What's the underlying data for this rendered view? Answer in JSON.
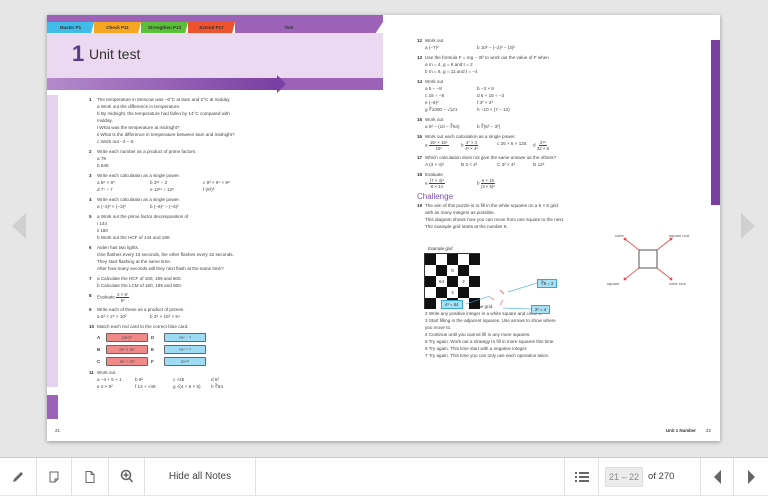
{
  "tabs": [
    {
      "label": "Master P1",
      "color": "#3fbde8"
    },
    {
      "label": "Check P11",
      "color": "#f5a623"
    },
    {
      "label": "Strengthen P13",
      "color": "#5cbf3a"
    },
    {
      "label": "Extend P17",
      "color": "#ee5330"
    },
    {
      "label": "Test",
      "color": "#9b62b8"
    }
  ],
  "header": {
    "unit_number": "1",
    "title": "Unit test"
  },
  "left_questions": [
    {
      "n": "1",
      "rows": [
        [
          "The temperature in Moscow was −6°C at 6am and 2°C at midday."
        ],
        [
          "a  Work out the difference in temperature."
        ],
        [
          "b  By midnight, the temperature had fallen by 14°C compared with"
        ],
        [
          "    midday."
        ],
        [
          "    i  What was the temperature at midnight?"
        ],
        [
          "    ii  What is the difference in temperature between 6am and midnight?"
        ],
        [
          "c  Work out −4 − 6."
        ]
      ]
    },
    {
      "n": "2",
      "rows": [
        [
          "Write each number as a product of prime factors."
        ],
        [
          "a  78"
        ],
        [
          "b  648"
        ]
      ]
    },
    {
      "n": "3",
      "rows": [
        [
          "Write each calculation as a single power."
        ],
        [
          "a  8⁶ × 8⁵",
          "b  3¹¹ ÷ 3",
          "c  9³ × 9⁷ × 9⁸"
        ],
        [
          "d  7⁷ ÷ 7",
          "e  12¹¹ ÷ 12⁵",
          "f  (6²)³"
        ]
      ]
    },
    {
      "n": "4",
      "rows": [
        [
          "Write each calculation as a single power."
        ],
        [
          "a  (−3)² × (−3)²",
          "b  (−6)⁷ ÷ (−6)²"
        ]
      ]
    },
    {
      "n": "5",
      "rows": [
        [
          "a  Work out the prime factor decomposition of"
        ],
        [
          "    i  144"
        ],
        [
          "    ii  180"
        ],
        [
          "b  Work out the HCF of 144 and 180."
        ]
      ]
    },
    {
      "n": "6",
      "rows": [
        [
          "Aiden has two lights."
        ],
        [
          "One flashes every 15 seconds, the other flashes every 42 seconds."
        ],
        [
          "They start flashing at the same time."
        ],
        [
          "After how many seconds will they next flash at the same time?"
        ]
      ]
    },
    {
      "n": "7",
      "rows": [
        [
          "a  Calculate the HCF of 180, 189 and 600."
        ],
        [
          "b  Calculate the LCM of 180, 189 and 600."
        ]
      ]
    },
    {
      "n": "8",
      "rows": [
        [
          "Evaluate {2 × 5⁷|5⁵}"
        ]
      ]
    },
    {
      "n": "9",
      "rows": [
        [
          "Write each of these as a product of primes."
        ],
        [
          "a  5³ × 2⁵ × 10²",
          "b  3⁵ × 15³ × 5⁴"
        ]
      ]
    },
    {
      "n": "10",
      "rows": [
        [
          "Match each red card to the correct blue card."
        ]
      ]
    }
  ],
  "cards": [
    {
      "letter": "A",
      "value": "(m⁴)³",
      "kind": "red"
    },
    {
      "letter": "D",
      "value": "m⁴ ⁻ ³",
      "kind": "blue"
    },
    {
      "letter": "B",
      "value": "m⁴ × m³",
      "kind": "red"
    },
    {
      "letter": "E",
      "value": "m⁴ ⁺ ³",
      "kind": "blue"
    },
    {
      "letter": "C",
      "value": "m⁴ ÷ m³",
      "kind": "red"
    },
    {
      "letter": "F",
      "value": "m⁴ˣ³",
      "kind": "blue"
    }
  ],
  "q11": {
    "n": "11",
    "rows": [
      [
        "Work out"
      ],
      [
        "a  −4 + 5 + 1",
        "b  9²",
        "c  √25",
        "d  5³"
      ],
      [
        "e  2 × 5²",
        "f  13 + √49",
        "g  √(4 + 9 × 5)",
        "h  ∛64"
      ]
    ]
  },
  "right_questions": [
    {
      "n": "12",
      "rows": [
        [
          "Work out"
        ],
        [
          "a  (−7)²",
          "b  10² − (−2)² − (3)²"
        ]
      ]
    },
    {
      "n": "13",
      "rows": [
        [
          "Use the formula F = mg − 3t² to work out the value of F when"
        ],
        [
          "a  m = 4, g = 6 and t = 2"
        ],
        [
          "b  m = 6, g = 11 and t = −4"
        ]
      ]
    },
    {
      "n": "14",
      "rows": [
        [
          "Work out"
        ],
        [
          "a  5 − −8",
          "b  −3 × 8"
        ],
        [
          "c  16 ÷ −8",
          "d  6 + 15 ÷ −3"
        ],
        [
          "e  (−6)²",
          "f  3² × 2³"
        ],
        [
          "g  ∛1000 − √121",
          "h  −10 × (7 − 12)"
        ]
      ]
    },
    {
      "n": "15",
      "rows": [
        [
          "Work out"
        ],
        [
          "a  5² − (10 − ∛64)",
          "b  ∛(6² − 3²)"
        ]
      ]
    },
    {
      "n": "16",
      "rows": [
        [
          "Work out each calculation as a single power."
        ],
        [
          "a  {15³ × 15⁵|15²}",
          "b  {4⁷ × 4|4² × 4³}",
          "c  25 × 5 × 125",
          "d  {2¹⁶|32 × 8}"
        ]
      ]
    },
    {
      "n": "17",
      "rows": [
        [
          "Which calculation does not give the same answer as the others?"
        ],
        [
          "A  (3 × 4)²",
          "B  3 × 4²",
          "C  3² × 4²",
          "D  12²"
        ]
      ]
    },
    {
      "n": "18",
      "rows": [
        [
          "Evaluate"
        ],
        [
          "a  {(7 × 4)²|8 × 14}",
          "b  {6 × 15|(3 × 5)²}"
        ]
      ]
    }
  ],
  "challenge": {
    "title": "Challenge",
    "n": "19",
    "intro": [
      "The aim of this puzzle is to fill in the white squares on a 5 × 5 grid",
      "with as many integers as possible.",
      "This diagram shows how you can move from one square to the next.",
      "The example grid starts at the number 8."
    ],
    "grid_caption": "Example grid",
    "grid_numbers": {
      "1-2": "8",
      "2-1": "64",
      "2-3": "2",
      "3-2": "4"
    },
    "labels": {
      "cube_root_label": "∛8 = 2",
      "cube_label": "4³ = 64",
      "square_label": "2² = 4"
    },
    "diagram": {
      "tl": "cube",
      "tr": "square root",
      "bl": "square",
      "br": "cube root"
    },
    "steps": [
      "1  Draw your own copy of the grid.",
      "2  Write any positive integer in a white square and circle it.",
      "3  Start filling in the adjacent squares. Use arrows to show where",
      "    you move to.",
      "4  Continue until you cannot fill in any more squares.",
      "5  Try again. Work out a strategy to fill in more squares this time.",
      "6  Try again. This time start with a negative integer.",
      "7  Try again. This time you can only use each operation twice."
    ]
  },
  "footer": {
    "left_page": "21",
    "right_label": "Unit 1 Number",
    "right_page": "22"
  },
  "toolbar": {
    "hide_notes": "Hide all Notes",
    "page_range": "21 – 22",
    "page_total": "of 270"
  }
}
